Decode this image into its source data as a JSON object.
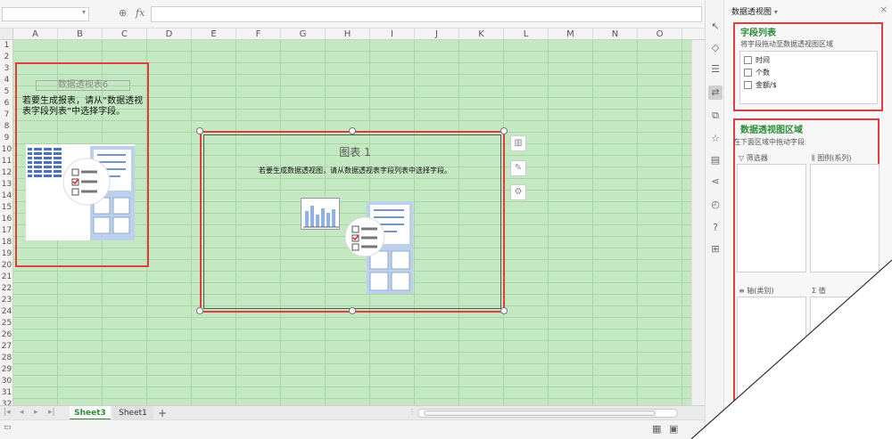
{
  "formula_bar": {
    "zoom_icon": "zoom-icon",
    "fx_label": "fx"
  },
  "columns": [
    "A",
    "B",
    "C",
    "D",
    "E",
    "F",
    "G",
    "H",
    "I",
    "J",
    "K",
    "L",
    "M",
    "N",
    "O"
  ],
  "rows": [
    "1",
    "2",
    "3",
    "4",
    "5",
    "6",
    "7",
    "8",
    "9",
    "10",
    "11",
    "12",
    "13",
    "14",
    "15",
    "16",
    "17",
    "18",
    "19",
    "20",
    "21",
    "22",
    "23",
    "24",
    "25",
    "26",
    "27",
    "28",
    "29",
    "30",
    "31",
    "32",
    "33"
  ],
  "pivot": {
    "title": "数据透视表6",
    "instruction": "若要生成报表，请从“数据透视表字段列表”中选择字段。"
  },
  "chart": {
    "title": "图表 1",
    "instruction": "若要生成数据透视图，请从数据透视表字段列表中选择字段。"
  },
  "sheets": [
    {
      "name": "Sheet3",
      "active": true
    },
    {
      "name": "Sheet1",
      "active": false
    }
  ],
  "add_sheet": "+",
  "panel": {
    "title": "数据透视图",
    "title_dropdown": "▾",
    "close": "×",
    "field_section": {
      "title": "字段列表",
      "desc": "将字段拖动至数据透视图区域",
      "fields": [
        "时间",
        "个数",
        "金额/$"
      ]
    },
    "area_section": {
      "title": "数据透视图区域",
      "desc": "在下面区域中拖动字段",
      "filter_label": "筛选器",
      "legend_label": "图例(系列)",
      "axis_label": "轴(类别)",
      "value_label": "值"
    }
  },
  "colors": {
    "grid_bg": "#c4e8c2",
    "highlight_red": "#e23c3c",
    "accent_green": "#2e8b3a",
    "illus_blue": "#4a72b8"
  }
}
